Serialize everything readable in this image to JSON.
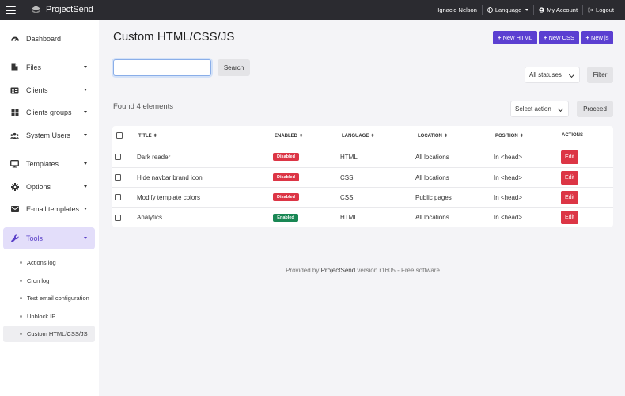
{
  "topbar": {
    "brand": "ProjectSend",
    "user": "Ignacio Nelson",
    "language": "Language",
    "account": "My Account",
    "logout": "Logout"
  },
  "sidebar": {
    "items": [
      {
        "label": "Dashboard",
        "icon": "dashboard-icon"
      },
      {
        "label": "Files",
        "icon": "file-icon"
      },
      {
        "label": "Clients",
        "icon": "id-card-icon"
      },
      {
        "label": "Clients groups",
        "icon": "grid-icon"
      },
      {
        "label": "System Users",
        "icon": "users-icon"
      },
      {
        "label": "Templates",
        "icon": "monitor-icon"
      },
      {
        "label": "Options",
        "icon": "gear-icon"
      },
      {
        "label": "E-mail templates",
        "icon": "envelope-icon"
      },
      {
        "label": "Tools",
        "icon": "wrench-icon"
      }
    ],
    "subitems": [
      "Actions log",
      "Cron log",
      "Test email configuration",
      "Unblock IP",
      "Custom HTML/CSS/JS"
    ]
  },
  "page": {
    "title": "Custom HTML/CSS/JS",
    "buttons": {
      "new_html": "New HTML",
      "new_css": "New CSS",
      "new_js": "New js"
    },
    "search_placeholder": "",
    "search_button": "Search",
    "status_filter": "All statuses",
    "filter_button": "Filter",
    "found": "Found 4 elements",
    "select_action": "Select action",
    "proceed": "Proceed"
  },
  "table": {
    "headers": [
      "TITLE",
      "ENABLED",
      "LANGUAGE",
      "LOCATION",
      "POSITION",
      "ACTIONS"
    ],
    "rows": [
      {
        "title": "Dark reader",
        "enabled": "Disabled",
        "language": "HTML",
        "location": "All locations",
        "position": "In <head>",
        "action": "Edit"
      },
      {
        "title": "Hide navbar brand icon",
        "enabled": "Disabled",
        "language": "CSS",
        "location": "All locations",
        "position": "In <head>",
        "action": "Edit"
      },
      {
        "title": "Modify template colors",
        "enabled": "Disabled",
        "language": "CSS",
        "location": "Public pages",
        "position": "In <head>",
        "action": "Edit"
      },
      {
        "title": "Analytics",
        "enabled": "Enabled",
        "language": "HTML",
        "location": "All locations",
        "position": "In <head>",
        "action": "Edit"
      }
    ]
  },
  "footer": {
    "prefix": "Provided by",
    "link": "ProjectSend",
    "suffix": "version r1605 - Free software"
  },
  "colors": {
    "accent": "#5b3fd1",
    "danger": "#dc3545",
    "success": "#198754",
    "topbar": "#2b2b30"
  }
}
